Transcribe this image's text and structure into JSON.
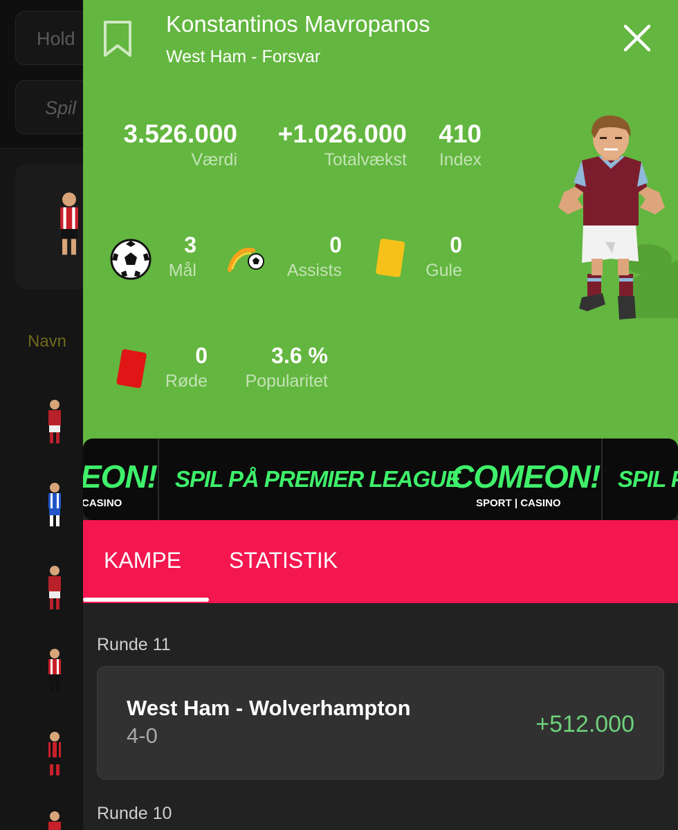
{
  "background": {
    "hold_button": "Hold",
    "spil_button": "Spil",
    "navn_header": "Navn"
  },
  "player": {
    "name": "Konstantinos Mavropanos",
    "team_position": "West Ham - Forsvar"
  },
  "stats_top": [
    {
      "value": "3.526.000",
      "label": "Værdi"
    },
    {
      "value": "+1.026.000",
      "label": "Totalvækst"
    },
    {
      "value": "410",
      "label": "Index"
    }
  ],
  "stats_mid": [
    {
      "value": "3",
      "label": "Mål",
      "icon": "football-icon"
    },
    {
      "value": "0",
      "label": "Assists",
      "icon": "assist-icon"
    },
    {
      "value": "0",
      "label": "Gule",
      "icon": "yellow-card-icon"
    }
  ],
  "stats_bottom": [
    {
      "value": "0",
      "label": "Røde",
      "icon": "red-card-icon"
    },
    {
      "value": "3.6 %",
      "label": "Popularitet"
    }
  ],
  "banner": {
    "brand_fragment": "EON!",
    "brand_fragment_sub": "CASINO",
    "slogan": "SPIL PÅ PREMIER LEAGUE",
    "brand": "COMEON!",
    "brand_sub": "SPORT | CASINO",
    "slogan_fragment": "SPIL P",
    "color_green": "#3ff06a"
  },
  "tabs": [
    {
      "label": "KAMPE",
      "active": true
    },
    {
      "label": "STATISTIK",
      "active": false
    }
  ],
  "rounds": [
    {
      "title": "Runde 11",
      "match": {
        "teams": "West Ham - Wolverhampton",
        "score": "4-0",
        "value": "+512.000"
      }
    },
    {
      "title": "Runde 10"
    }
  ],
  "colors": {
    "header_green": "#63b63f",
    "tab_bar": "#f3164f",
    "positive_value": "#6ed17b"
  }
}
